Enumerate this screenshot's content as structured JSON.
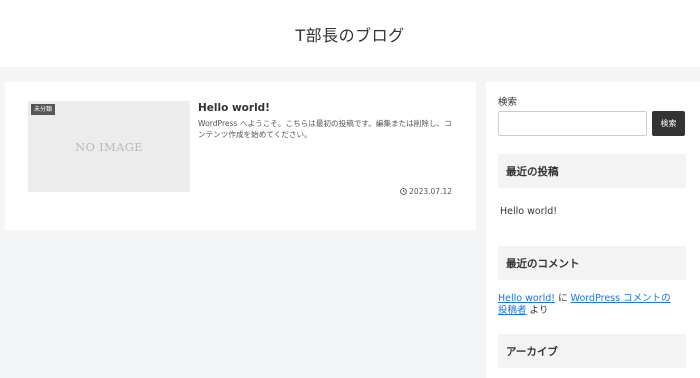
{
  "header": {
    "site_title": "T部長のブログ"
  },
  "main": {
    "post": {
      "category": "未分類",
      "thumbnail_text": "NO IMAGE",
      "title": "Hello world!",
      "snippet": "WordPress へようこそ。こちらは最初の投稿です。編集または削除し、コンテンツ作成を始めてください。",
      "date": "2023.07.12"
    }
  },
  "sidebar": {
    "search": {
      "label": "検索",
      "button_label": "検索",
      "value": ""
    },
    "recent_posts": {
      "heading": "最近の投稿",
      "items": [
        "Hello world!"
      ]
    },
    "recent_comments": {
      "heading": "最近のコメント",
      "post_link": "Hello world!",
      "on_text": "に",
      "commenter_line1": "WordPress コメントの",
      "commenter_line2": "投稿者",
      "suffix": "より"
    },
    "archives": {
      "heading": "アーカイブ"
    }
  }
}
